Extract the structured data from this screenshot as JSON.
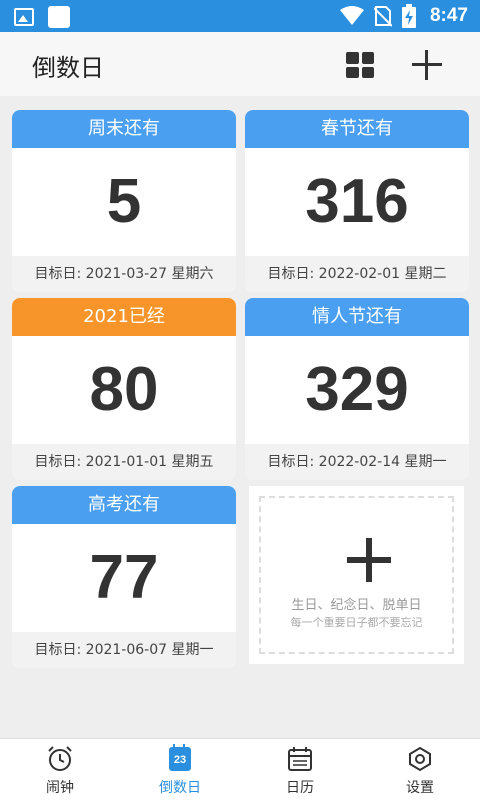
{
  "status_bar": {
    "time": "8:47",
    "icons": [
      "image-icon",
      "app-icon",
      "wifi-icon",
      "no-sim-icon",
      "battery-charging-icon"
    ]
  },
  "header": {
    "title": "倒数日",
    "icons": [
      "grid-view-icon",
      "add-icon"
    ]
  },
  "cards": [
    {
      "title": "周末还有",
      "number": "5",
      "footer": "目标日: 2021-03-27 星期六",
      "color": "#4a9ff0"
    },
    {
      "title": "春节还有",
      "number": "316",
      "footer": "目标日: 2022-02-01 星期二",
      "color": "#4a9ff0"
    },
    {
      "title": "2021已经",
      "number": "80",
      "footer": "目标日: 2021-01-01 星期五",
      "color": "#f7952a"
    },
    {
      "title": "情人节还有",
      "number": "329",
      "footer": "目标日: 2022-02-14 星期一",
      "color": "#4a9ff0"
    },
    {
      "title": "高考还有",
      "number": "77",
      "footer": "目标日: 2021-06-07 星期一",
      "color": "#4a9ff0"
    }
  ],
  "add_card": {
    "line1": "生日、纪念日、脱单日",
    "line2": "每一个重要日子都不要忘记"
  },
  "bottom_nav": {
    "items": [
      {
        "label": "闹钟",
        "icon": "alarm-clock-icon"
      },
      {
        "label": "倒数日",
        "icon": "calendar-23-icon",
        "icon_text": "23",
        "active": true
      },
      {
        "label": "日历",
        "icon": "calendar-icon"
      },
      {
        "label": "设置",
        "icon": "settings-icon"
      }
    ],
    "active_color": "#2b8fe0"
  }
}
